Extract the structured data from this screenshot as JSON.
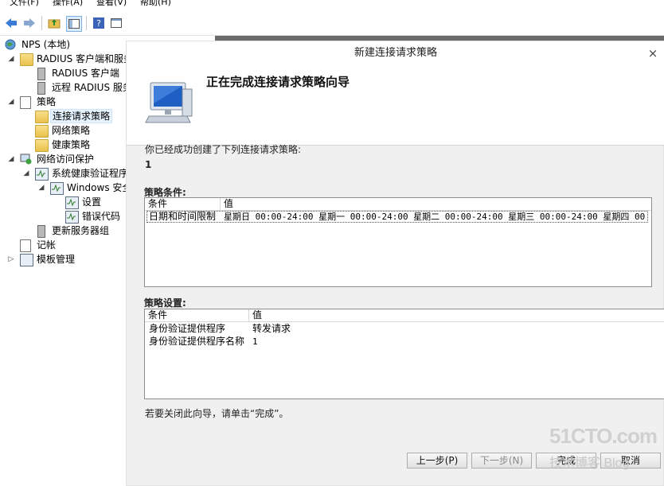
{
  "menu": [
    "文件(F)",
    "操作(A)",
    "查看(V)",
    "帮助(H)"
  ],
  "tree": [
    {
      "label": "NPS (本地)",
      "icon": "globe-icon"
    },
    {
      "label": "RADIUS 客户端和服务器",
      "icon": "folder-icon"
    },
    {
      "label": "RADIUS 客户端",
      "icon": "server-icon"
    },
    {
      "label": "远程 RADIUS 服务器组",
      "icon": "server-icon"
    },
    {
      "label": "策略",
      "icon": "policy-icon"
    },
    {
      "label": "连接请求策略",
      "icon": "folder-icon"
    },
    {
      "label": "网络策略",
      "icon": "folder-icon"
    },
    {
      "label": "健康策略",
      "icon": "folder-icon"
    },
    {
      "label": "网络访问保护",
      "icon": "nap-icon"
    },
    {
      "label": "系统健康验证程序",
      "icon": "health-icon"
    },
    {
      "label": "Windows 安全健康验证程序",
      "icon": "health-icon"
    },
    {
      "label": "设置",
      "icon": "health-icon"
    },
    {
      "label": "错误代码",
      "icon": "health-icon"
    },
    {
      "label": "更新服务器组",
      "icon": "server-icon"
    },
    {
      "label": "记帐",
      "icon": "doc-icon"
    },
    {
      "label": "模板管理",
      "icon": "monitor-icon"
    }
  ],
  "dialog": {
    "title": "新建连接请求策略",
    "close": "×",
    "heading": "正在完成连接请求策略向导",
    "intro": "你已经成功创建了下列连接请求策略:",
    "policy_name": "1",
    "conditions_label": "策略条件:",
    "conditions_headers": [
      "条件",
      "值"
    ],
    "conditions_rows": [
      {
        "cond": "日期和时间限制",
        "value": "星期日 00:00-24:00 星期一 00:00-24:00 星期二 00:00-24:00 星期三 00:00-24:00 星期四 00..."
      }
    ],
    "settings_label": "策略设置:",
    "settings_headers": [
      "条件",
      "值"
    ],
    "settings_rows": [
      {
        "cond": "身份验证提供程序",
        "value": "转发请求"
      },
      {
        "cond": "身份验证提供程序名称",
        "value": "1"
      }
    ],
    "footer": "若要关闭此向导，请单击“完成”。",
    "buttons": {
      "prev": "上一步(P)",
      "next": "下一步(N)",
      "finish": "完成",
      "cancel": "取消"
    }
  },
  "watermark": {
    "line1": "51CTO.com",
    "line2": "技术博客 Blog"
  }
}
